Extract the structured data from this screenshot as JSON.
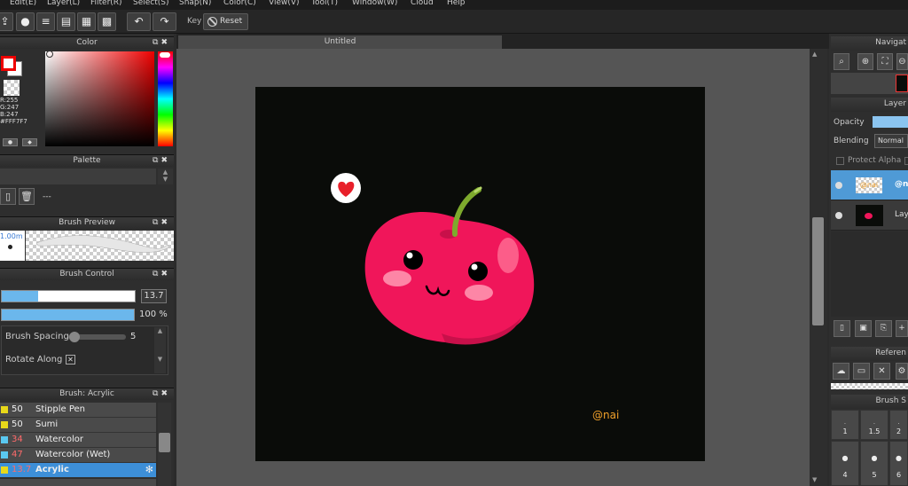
{
  "menu": [
    "Edit(E)",
    "Layer(L)",
    "Filter(R)",
    "Select(S)",
    "Snap(N)",
    "Color(C)",
    "View(V)",
    "Tool(T)",
    "Window(W)",
    "Cloud",
    "Help"
  ],
  "toolbar": {
    "key_label": "Key",
    "reset_label": "Reset"
  },
  "canvas": {
    "tab_title": "Untitled",
    "signature": "@nai"
  },
  "color_panel": {
    "title": "Color",
    "r": "R:255",
    "g": "G:247",
    "b": "B:247",
    "hex": "#FFF7F7",
    "fg_color": "#ff0000",
    "bg_color": "#ffffff"
  },
  "palette_panel": {
    "title": "Palette",
    "value": "---"
  },
  "brush_preview": {
    "title": "Brush Preview",
    "size": "1.00m"
  },
  "brush_control": {
    "title": "Brush Control",
    "size_value": "13.7",
    "opacity_value": "100 %",
    "spacing_label": "Brush Spacing",
    "spacing_value": "5",
    "rotate_label": "Rotate Along",
    "size_fraction": 0.27,
    "opacity_fraction": 1.0
  },
  "brush_list": {
    "title": "Brush: Acrylic",
    "items": [
      {
        "size": "50",
        "name": "Stipple Pen",
        "color": "#e8d81a"
      },
      {
        "size": "50",
        "name": "Sumi",
        "color": "#e8d81a"
      },
      {
        "size": "34",
        "name": "Watercolor",
        "color": "#5ac8f0"
      },
      {
        "size": "47",
        "name": "Watercolor (Wet)",
        "color": "#5ac8f0"
      },
      {
        "size": "13.7",
        "name": "Acrylic",
        "color": "#e8d81a"
      }
    ]
  },
  "navigator": {
    "title": "Navigat"
  },
  "layers": {
    "title": "Layer",
    "opacity_label": "Opacity",
    "blending_label": "Blending",
    "blending_value": "Normal",
    "protect_alpha_label": "Protect Alpha",
    "items": [
      {
        "name": "@n",
        "thumb": "@nai"
      },
      {
        "name": "Lay"
      }
    ]
  },
  "reference": {
    "title": "Referen"
  },
  "brush_size": {
    "title": "Brush S",
    "sizes": [
      "1",
      "1.5",
      "2",
      "4",
      "5",
      "6"
    ]
  },
  "colors": {
    "accent": "#5aa9e6",
    "cherry": "#f0165a",
    "artboard": "#0a0c09"
  }
}
